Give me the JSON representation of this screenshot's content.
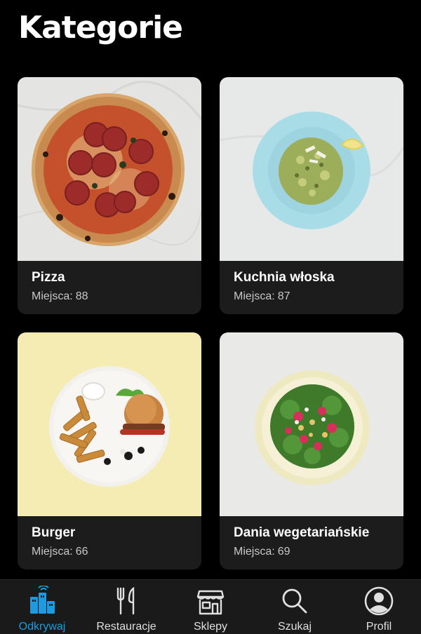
{
  "header": {
    "title": "Kategorie"
  },
  "categories": [
    {
      "name": "Pizza",
      "count_label": "Miejsca:",
      "count": 88,
      "image": "pizza"
    },
    {
      "name": "Kuchnia włoska",
      "count_label": "Miejsca:",
      "count": 87,
      "image": "risotto-plate"
    },
    {
      "name": "Burger",
      "count_label": "Miejsca:",
      "count": 66,
      "image": "burger-and-fries"
    },
    {
      "name": "Dania wegetariańskie",
      "count_label": "Miejsca:",
      "count": 69,
      "image": "salad-bowl"
    }
  ],
  "tabbar": {
    "active_color": "#1e9be0",
    "tabs": [
      {
        "label": "Odkrywaj",
        "icon": "city-icon",
        "active": true
      },
      {
        "label": "Restauracje",
        "icon": "fork-knife-icon",
        "active": false
      },
      {
        "label": "Sklepy",
        "icon": "store-icon",
        "active": false
      },
      {
        "label": "Szukaj",
        "icon": "search-icon",
        "active": false
      },
      {
        "label": "Profil",
        "icon": "profile-icon",
        "active": false
      }
    ]
  }
}
